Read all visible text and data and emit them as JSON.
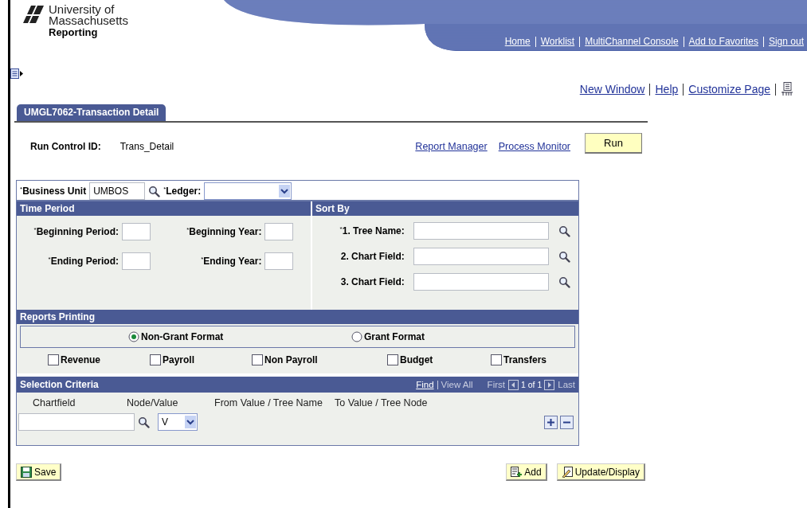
{
  "header": {
    "logo_lines": [
      "University of",
      "Massachusetts"
    ],
    "subtitle": "Reporting",
    "nav_links": [
      "Home",
      "Worklist",
      "MultiChannel Console",
      "Add to Favorites",
      "Sign out"
    ]
  },
  "page_links": [
    "New Window",
    "Help",
    "Customize Page"
  ],
  "tabs": [
    {
      "label": "UMGL7062-Transaction Detail",
      "selected": true
    }
  ],
  "run_control": {
    "label": "Run Control ID:",
    "value": "Trans_Detail",
    "links": [
      "Report Manager",
      "Process Monitor"
    ],
    "run_button": "Run"
  },
  "criteria": {
    "business_unit": {
      "mark": "*",
      "label": "Business Unit",
      "value": "UMBOS"
    },
    "ledger": {
      "mark": "*",
      "label": "Ledger:"
    }
  },
  "time_period": {
    "title": "Time Period",
    "fields": [
      {
        "mark": "*",
        "label": "Beginning Period:"
      },
      {
        "mark": "*",
        "label": "Beginning Year:"
      },
      {
        "mark": "*",
        "label": "Ending Period:"
      },
      {
        "mark": "*",
        "label": "Ending Year:"
      }
    ]
  },
  "sort_by": {
    "title": "Sort By",
    "fields": [
      {
        "mark": "*",
        "label": "1. Tree Name:"
      },
      {
        "label": "2. Chart Field:"
      },
      {
        "label": "3. Chart Field:"
      }
    ]
  },
  "reports_printing": {
    "title": "Reports Printing",
    "formats": [
      {
        "label": "Non-Grant Format",
        "selected": true
      },
      {
        "label": "Grant Format",
        "selected": false
      }
    ],
    "options": [
      {
        "label": "Revenue",
        "checked": false
      },
      {
        "label": "Payroll",
        "checked": false
      },
      {
        "label": "Non Payroll",
        "checked": false
      },
      {
        "label": "Budget",
        "checked": false
      },
      {
        "label": "Transfers",
        "checked": false
      }
    ]
  },
  "selection_criteria": {
    "title": "Selection Criteria",
    "find": "Find",
    "view_all": "View All",
    "first": "First",
    "position": "1 of 1",
    "last": "Last",
    "columns": [
      "Chartfield",
      "Node/Value",
      "From Value / Tree Name",
      "To Value / Tree Node"
    ],
    "rows": [
      {
        "node_value": "V"
      }
    ]
  },
  "bottom_buttons": [
    {
      "kind": "save",
      "label": "Save"
    },
    {
      "kind": "add",
      "label": "Add"
    },
    {
      "kind": "update",
      "label": "Update/Display"
    }
  ]
}
